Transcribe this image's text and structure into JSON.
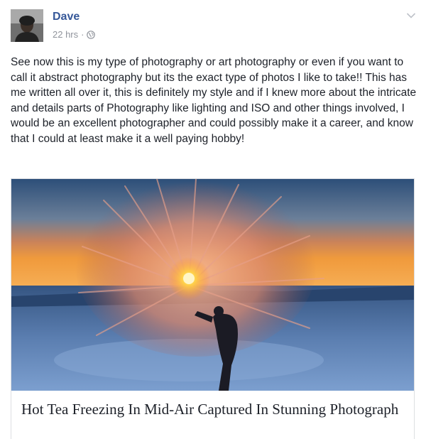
{
  "post": {
    "author": "Dave",
    "timestamp": "22 hrs",
    "separator": "·",
    "privacy_icon": "globe-icon",
    "menu_icon": "chevron-down-icon",
    "text": "See now this is my type of photography or art photography or even if you want to call it abstract photography but its the exact type of photos I like to take!! This has me written all over it, this is definitely my style and if I knew more about the intricate and details parts of Photography like lighting and ISO and other things involved, I would be an excellent photographer and could possibly make it a career, and know that I could at least make it a well paying hobby!"
  },
  "link_preview": {
    "title": "Hot Tea Freezing In Mid-Air Captured In Stunning Photograph"
  },
  "colors": {
    "name_link": "#365899",
    "meta_gray": "#90949c",
    "text": "#1d2129",
    "border": "#dddfe2"
  }
}
